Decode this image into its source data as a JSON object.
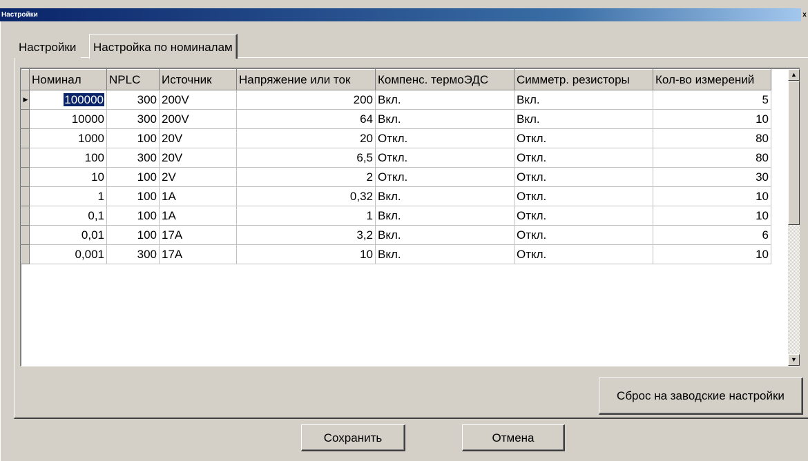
{
  "window": {
    "title": "Настройки",
    "close_glyph": "x"
  },
  "tabs": [
    {
      "label": "Настройки",
      "active": false
    },
    {
      "label": "Настройка по номиналам",
      "active": true
    }
  ],
  "grid": {
    "columns": [
      "Номинал",
      "NPLC",
      "Источник",
      "Напряжение или ток",
      "Компенс. термоЭДС",
      "Симметр. резисторы",
      "Кол-во измерений"
    ],
    "rows": [
      [
        "100000",
        "300",
        "200V",
        "200",
        "Вкл.",
        "Вкл.",
        "5"
      ],
      [
        "10000",
        "300",
        "200V",
        "64",
        "Вкл.",
        "Вкл.",
        "10"
      ],
      [
        "1000",
        "100",
        "20V",
        "20",
        "Откл.",
        "Откл.",
        "80"
      ],
      [
        "100",
        "300",
        "20V",
        "6,5",
        "Откл.",
        "Откл.",
        "80"
      ],
      [
        "10",
        "100",
        "2V",
        "2",
        "Откл.",
        "Откл.",
        "30"
      ],
      [
        "1",
        "100",
        "1A",
        "0,32",
        "Вкл.",
        "Откл.",
        "10"
      ],
      [
        "0,1",
        "100",
        "1A",
        "1",
        "Вкл.",
        "Откл.",
        "10"
      ],
      [
        "0,01",
        "100",
        "17A",
        "3,2",
        "Вкл.",
        "Откл.",
        "6"
      ],
      [
        "0,001",
        "300",
        "17A",
        "10",
        "Вкл.",
        "Откл.",
        "10"
      ]
    ],
    "selected_row": 0,
    "current_row_marker": "▶"
  },
  "scrollbar": {
    "up_glyph": "▲",
    "down_glyph": "▼"
  },
  "buttons": {
    "reset_label": "Сброс на заводские настройки",
    "save_label": "Сохранить",
    "cancel_label": "Отмена"
  },
  "colors": {
    "face": "#d4d0c8",
    "selection": "#0a246a",
    "title_start": "#0a246a",
    "title_end": "#a6caf0"
  }
}
